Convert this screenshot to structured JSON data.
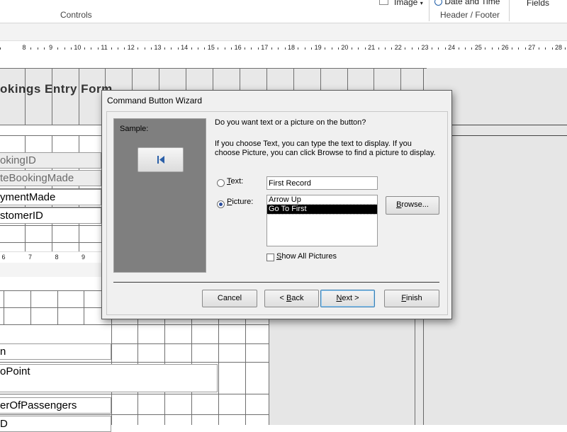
{
  "ribbon": {
    "controls_label": "Controls",
    "header_footer_label": "Header / Footer",
    "image_label": "Image",
    "date_time_label": "Date and Time",
    "fields_label": "Fields"
  },
  "ruler": {
    "labels": [
      "8",
      "9",
      "10",
      "11",
      "12",
      "13",
      "14",
      "15",
      "16",
      "17",
      "18",
      "19",
      "20",
      "21",
      "22",
      "23",
      "24",
      "25",
      "26",
      "27",
      "28"
    ],
    "lower_labels": [
      "6",
      "7",
      "8",
      "9"
    ]
  },
  "form": {
    "title": "okings Entry Form",
    "fields": [
      "okingID",
      "teBookingMade",
      "ymentMade",
      "stomerID",
      "n",
      "oPoint",
      "erOfPassengers",
      "D"
    ]
  },
  "dialog": {
    "title": "Command Button Wizard",
    "sample_label": "Sample:",
    "question": "Do you want text or a picture on the button?",
    "help_line1": "If you choose Text, you can type the text to display.  If you",
    "help_line2": "choose Picture, you can click Browse to find a picture to display.",
    "text_option": {
      "hotkey": "T",
      "rest": "ext:"
    },
    "picture_option": {
      "hotkey": "P",
      "rest": "icture:"
    },
    "text_value": "First Record",
    "picture_list": [
      "Arrow Up",
      "Go To First"
    ],
    "selected_picture": "Go To First",
    "browse": {
      "hotkey": "B",
      "rest": "rowse..."
    },
    "show_all": {
      "hotkey": "S",
      "rest": "how All Pictures"
    },
    "buttons": {
      "cancel": "Cancel",
      "back": {
        "prefix": "< ",
        "hotkey": "B",
        "rest": "ack"
      },
      "next": {
        "hotkey": "N",
        "rest": "ext >"
      },
      "finish": {
        "hotkey": "F",
        "rest": "inish"
      }
    }
  },
  "colors": {
    "accent": "#2a4d9c",
    "sample_panel": "#7f7f7f",
    "dialog_bg": "#f0f0f0"
  }
}
